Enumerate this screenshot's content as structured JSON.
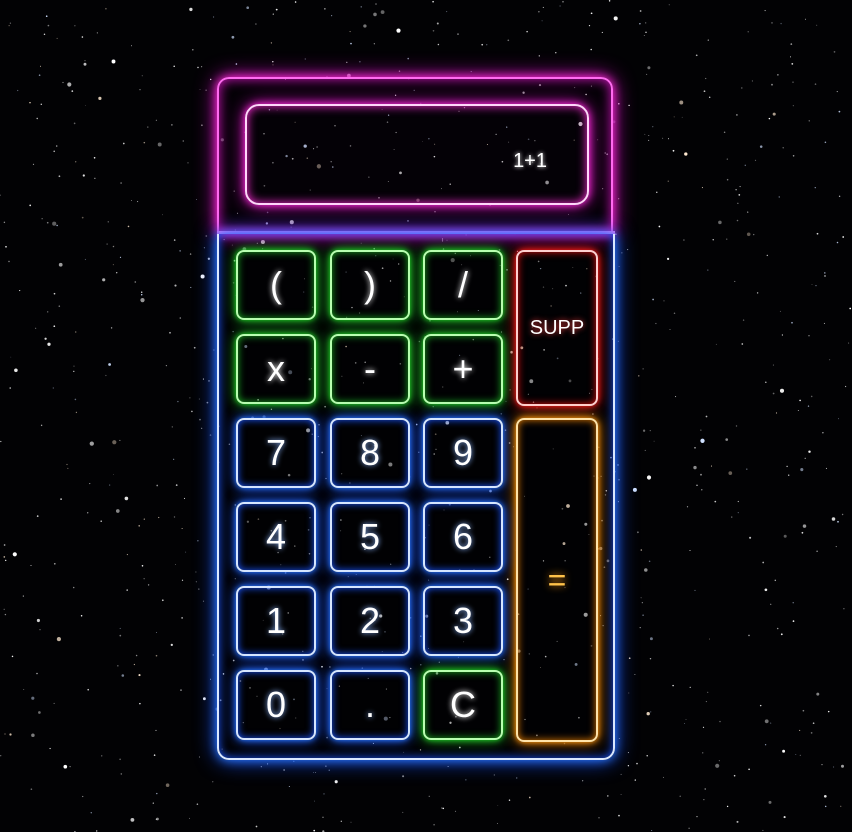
{
  "display": {
    "value": "1+1"
  },
  "keys": {
    "open_paren": "(",
    "close_paren": ")",
    "divide": "/",
    "delete": "SUPP",
    "multiply": "x",
    "minus": "-",
    "plus": "+",
    "seven": "7",
    "eight": "8",
    "nine": "9",
    "four": "4",
    "five": "5",
    "six": "6",
    "one": "1",
    "two": "2",
    "three": "3",
    "zero": "0",
    "decimal": ".",
    "clear": "C",
    "equals": "="
  },
  "colors": {
    "screen_neon": "#ff2bd9",
    "body_neon": "#2b7bff",
    "operator_neon": "#22d428",
    "delete_neon": "#ff2020",
    "equals_neon": "#ff9a10"
  }
}
